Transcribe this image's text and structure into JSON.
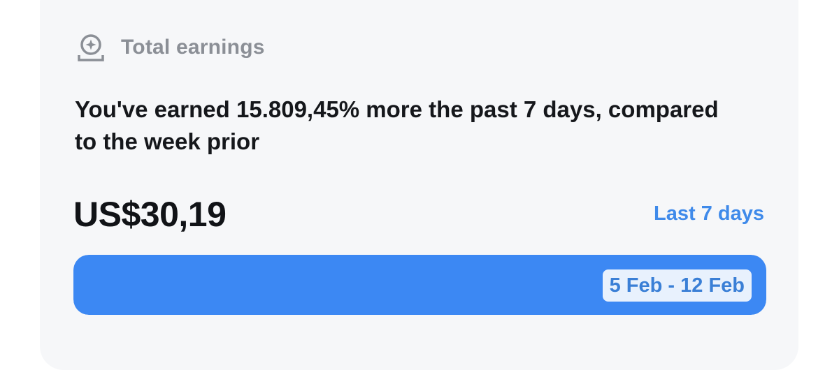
{
  "card": {
    "header": {
      "icon": "star-coin-icon",
      "label": "Total earnings"
    },
    "message": "You've earned 15.809,45% more the past 7 days, compared to the week prior",
    "amount": "US$30,19",
    "period_link": "Last 7 days",
    "bar": {
      "fill_fraction": 1.0,
      "date_range": "5 Feb - 12 Feb"
    }
  },
  "colors": {
    "card_background": "#f6f7f9",
    "accent": "#3f8aea",
    "bar_fill": "#3c88f3",
    "muted_text": "#8b8f96",
    "primary_text": "#15171b"
  }
}
